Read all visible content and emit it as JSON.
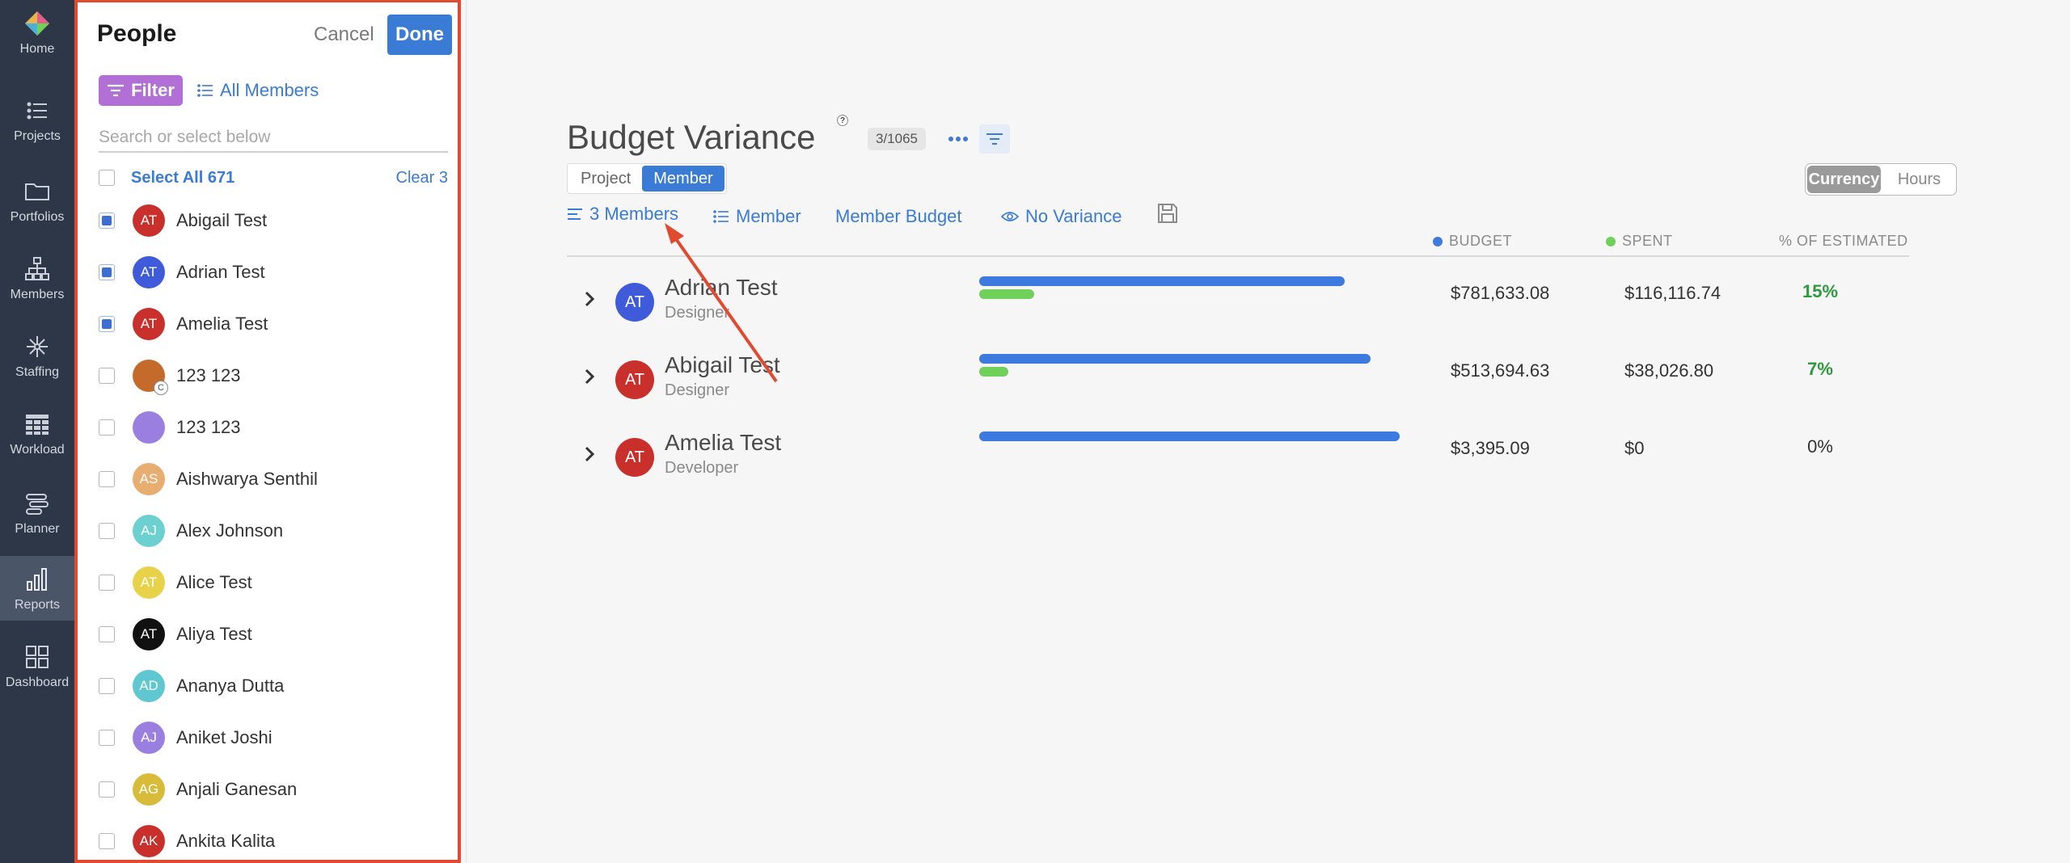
{
  "nav": {
    "items": [
      {
        "label": "Home",
        "icon": "logo-icon"
      },
      {
        "label": "Projects",
        "icon": "list-icon"
      },
      {
        "label": "Portfolios",
        "icon": "folder-icon"
      },
      {
        "label": "Members",
        "icon": "org-chart-icon"
      },
      {
        "label": "Staffing",
        "icon": "network-icon"
      },
      {
        "label": "Workload",
        "icon": "grid-icon"
      },
      {
        "label": "Planner",
        "icon": "timeline-icon"
      },
      {
        "label": "Reports",
        "icon": "bar-chart-icon"
      },
      {
        "label": "Dashboard",
        "icon": "dashboard-icon"
      }
    ],
    "active": "Reports"
  },
  "panel": {
    "title": "People",
    "cancel_label": "Cancel",
    "done_label": "Done",
    "filter_label": "Filter",
    "all_members_label": "All Members",
    "search_placeholder": "Search or select below",
    "select_all_label": "Select All 671",
    "clear_label": "Clear 3",
    "members": [
      {
        "name": "Abigail Test",
        "initials": "AT",
        "color": "#c9302c",
        "checked": true
      },
      {
        "name": "Adrian Test",
        "initials": "AT",
        "color": "#3f5bd9",
        "checked": true
      },
      {
        "name": "Amelia Test",
        "initials": "AT",
        "color": "#c9302c",
        "checked": true
      },
      {
        "name": "123 123",
        "initials": "",
        "color": "#c46a2a",
        "checked": false,
        "sub": "C"
      },
      {
        "name": "123 123",
        "initials": "",
        "color": "#9b7fe0",
        "checked": false
      },
      {
        "name": "Aishwarya Senthil",
        "initials": "AS",
        "color": "#e8ad70",
        "checked": false
      },
      {
        "name": "Alex Johnson",
        "initials": "AJ",
        "color": "#6ccfd0",
        "checked": false
      },
      {
        "name": "Alice Test",
        "initials": "AT",
        "color": "#e8d24a",
        "checked": false
      },
      {
        "name": "Aliya Test",
        "initials": "AT",
        "color": "#111111",
        "checked": false
      },
      {
        "name": "Ananya Dutta",
        "initials": "AD",
        "color": "#5ec7cf",
        "checked": false
      },
      {
        "name": "Aniket Joshi",
        "initials": "AJ",
        "color": "#9b7fe0",
        "checked": false
      },
      {
        "name": "Anjali Ganesan",
        "initials": "AG",
        "color": "#d9bb3a",
        "checked": false
      },
      {
        "name": "Ankita Kalita",
        "initials": "AK",
        "color": "#c9302c",
        "checked": false
      }
    ]
  },
  "report": {
    "title": "Budget Variance",
    "help": "?",
    "count": "3/1065",
    "view_toggle": {
      "options": [
        "Project",
        "Member"
      ],
      "active": "Member"
    },
    "unit_toggle": {
      "options": [
        "Currency",
        "Hours"
      ],
      "active": "Currency"
    },
    "toolbar": {
      "members_filter": "3 Members",
      "group_by": "Member",
      "budget_type": "Member Budget",
      "variance": "No Variance"
    },
    "columns": {
      "budget": "BUDGET",
      "spent": "SPENT",
      "pct": "% OF ESTIMATED",
      "budget_color": "#3d7ae0",
      "spent_color": "#6fd05a"
    },
    "rows": [
      {
        "initials": "AT",
        "name": "Adrian Test",
        "role": "Designer",
        "color": "#3f5bd9",
        "budget": "$781,633.08",
        "spent": "$116,116.74",
        "pct": "15%",
        "budget_fill": 0.87,
        "spent_fill": 0.13,
        "highlight": true
      },
      {
        "initials": "AT",
        "name": "Abigail Test",
        "role": "Designer",
        "color": "#c9302c",
        "budget": "$513,694.63",
        "spent": "$38,026.80",
        "pct": "7%",
        "budget_fill": 0.93,
        "spent_fill": 0.07,
        "highlight": true
      },
      {
        "initials": "AT",
        "name": "Amelia Test",
        "role": "Developer",
        "color": "#c9302c",
        "budget": "$3,395.09",
        "spent": "$0",
        "pct": "0%",
        "budget_fill": 1.0,
        "spent_fill": 0.0,
        "highlight": false
      }
    ]
  },
  "colors": {
    "accent": "#3a7bd5",
    "annotation": "#e04a2f"
  }
}
